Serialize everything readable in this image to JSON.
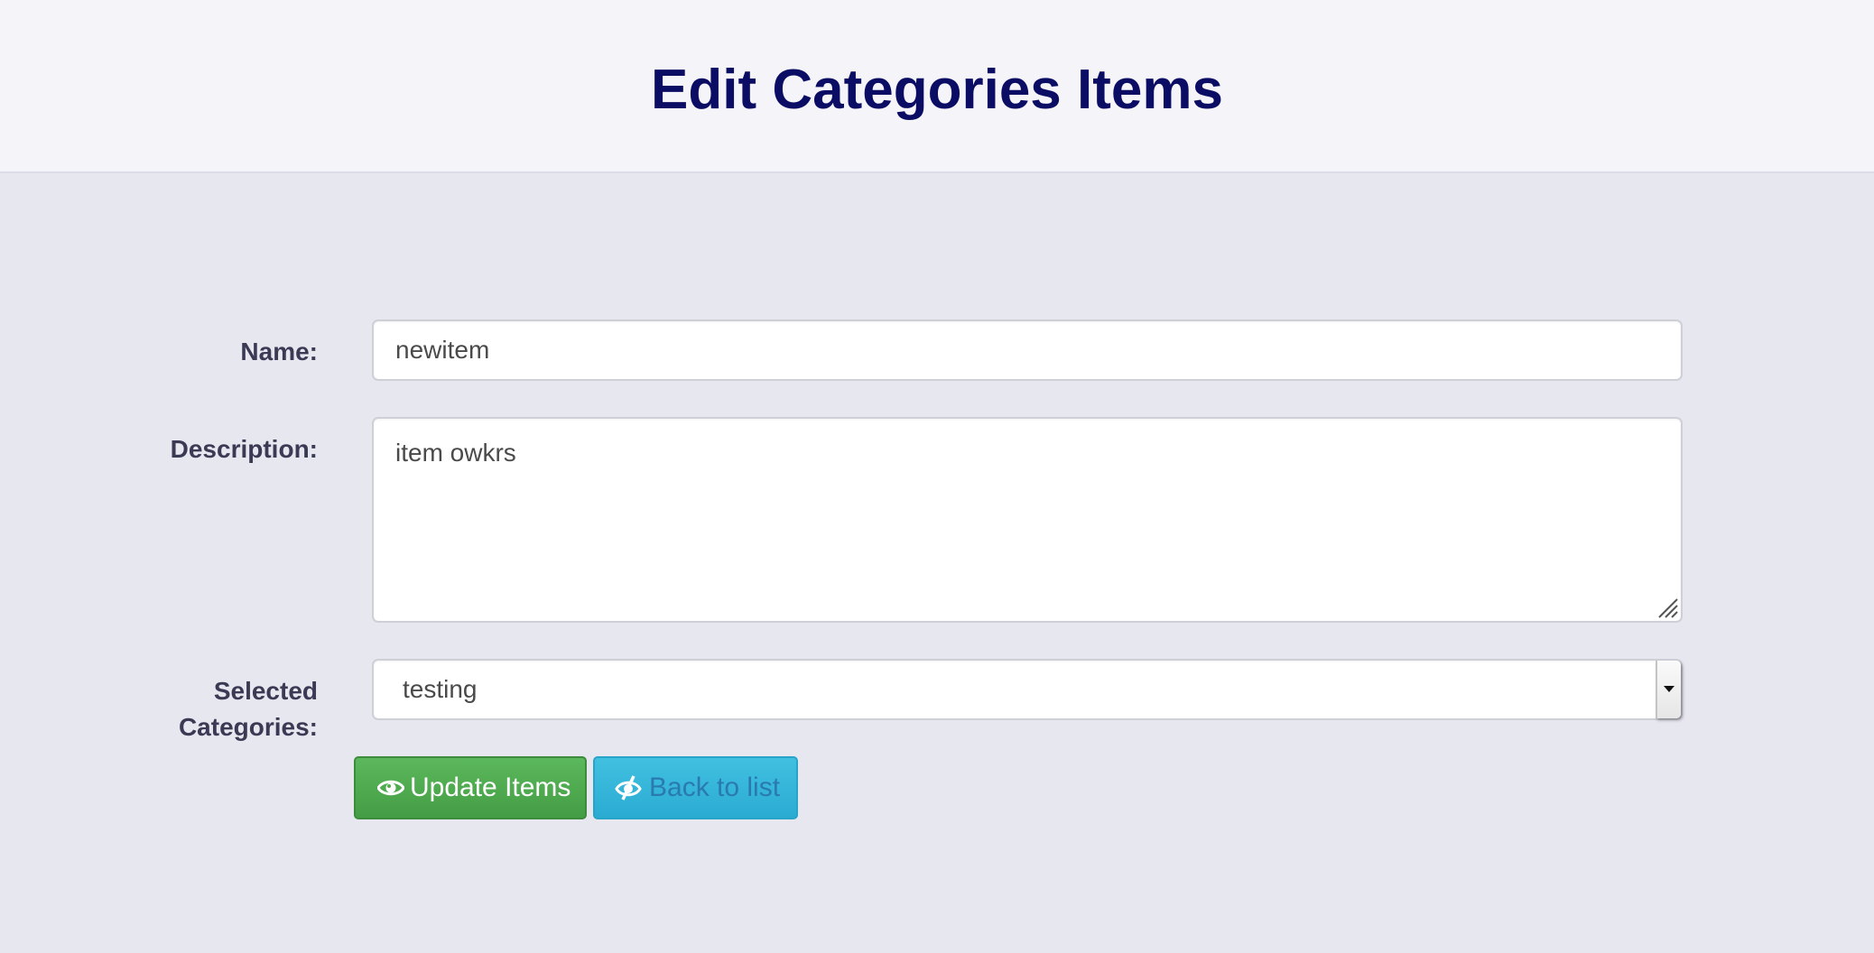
{
  "header": {
    "title": "Edit Categories Items"
  },
  "form": {
    "name": {
      "label": "Name:",
      "value": "newitem"
    },
    "description": {
      "label": "Description:",
      "value": "item owkrs"
    },
    "categories": {
      "label_line1": "Selected",
      "label_line2": "Categories:",
      "selected": "testing"
    }
  },
  "buttons": {
    "update_label": "Update Items",
    "update_icon": "eye-icon",
    "back_label": "Back to list",
    "back_icon": "eye-slash-icon"
  },
  "colors": {
    "title": "#0b0c63",
    "update_button": "#4cae4c",
    "back_button": "#31b0d5",
    "background": "#e7e7f0"
  }
}
